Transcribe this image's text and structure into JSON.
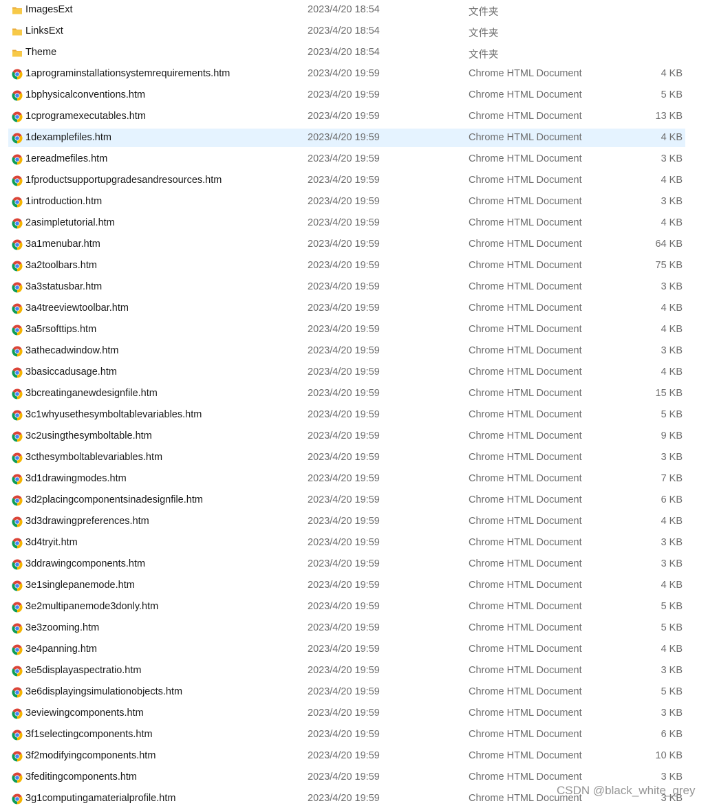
{
  "files": [
    {
      "name": "ImagesExt",
      "date": "2023/4/20 18:54",
      "type": "文件夹",
      "size": "",
      "kind": "folder"
    },
    {
      "name": "LinksExt",
      "date": "2023/4/20 18:54",
      "type": "文件夹",
      "size": "",
      "kind": "folder"
    },
    {
      "name": "Theme",
      "date": "2023/4/20 18:54",
      "type": "文件夹",
      "size": "",
      "kind": "folder"
    },
    {
      "name": "1aprograminstallationsystemrequirements.htm",
      "date": "2023/4/20 19:59",
      "type": "Chrome HTML Document",
      "size": "4 KB",
      "kind": "chrome"
    },
    {
      "name": "1bphysicalconventions.htm",
      "date": "2023/4/20 19:59",
      "type": "Chrome HTML Document",
      "size": "5 KB",
      "kind": "chrome"
    },
    {
      "name": "1cprogramexecutables.htm",
      "date": "2023/4/20 19:59",
      "type": "Chrome HTML Document",
      "size": "13 KB",
      "kind": "chrome"
    },
    {
      "name": "1dexamplefiles.htm",
      "date": "2023/4/20 19:59",
      "type": "Chrome HTML Document",
      "size": "4 KB",
      "kind": "chrome",
      "selected": true
    },
    {
      "name": "1ereadmefiles.htm",
      "date": "2023/4/20 19:59",
      "type": "Chrome HTML Document",
      "size": "3 KB",
      "kind": "chrome"
    },
    {
      "name": "1fproductsupportupgradesandresources.htm",
      "date": "2023/4/20 19:59",
      "type": "Chrome HTML Document",
      "size": "4 KB",
      "kind": "chrome"
    },
    {
      "name": "1introduction.htm",
      "date": "2023/4/20 19:59",
      "type": "Chrome HTML Document",
      "size": "3 KB",
      "kind": "chrome"
    },
    {
      "name": "2asimpletutorial.htm",
      "date": "2023/4/20 19:59",
      "type": "Chrome HTML Document",
      "size": "4 KB",
      "kind": "chrome"
    },
    {
      "name": "3a1menubar.htm",
      "date": "2023/4/20 19:59",
      "type": "Chrome HTML Document",
      "size": "64 KB",
      "kind": "chrome"
    },
    {
      "name": "3a2toolbars.htm",
      "date": "2023/4/20 19:59",
      "type": "Chrome HTML Document",
      "size": "75 KB",
      "kind": "chrome"
    },
    {
      "name": "3a3statusbar.htm",
      "date": "2023/4/20 19:59",
      "type": "Chrome HTML Document",
      "size": "3 KB",
      "kind": "chrome"
    },
    {
      "name": "3a4treeviewtoolbar.htm",
      "date": "2023/4/20 19:59",
      "type": "Chrome HTML Document",
      "size": "4 KB",
      "kind": "chrome"
    },
    {
      "name": "3a5rsofttips.htm",
      "date": "2023/4/20 19:59",
      "type": "Chrome HTML Document",
      "size": "4 KB",
      "kind": "chrome"
    },
    {
      "name": "3athecadwindow.htm",
      "date": "2023/4/20 19:59",
      "type": "Chrome HTML Document",
      "size": "3 KB",
      "kind": "chrome"
    },
    {
      "name": "3basiccadusage.htm",
      "date": "2023/4/20 19:59",
      "type": "Chrome HTML Document",
      "size": "4 KB",
      "kind": "chrome"
    },
    {
      "name": "3bcreatinganewdesignfile.htm",
      "date": "2023/4/20 19:59",
      "type": "Chrome HTML Document",
      "size": "15 KB",
      "kind": "chrome"
    },
    {
      "name": "3c1whyusethesymboltablevariables.htm",
      "date": "2023/4/20 19:59",
      "type": "Chrome HTML Document",
      "size": "5 KB",
      "kind": "chrome"
    },
    {
      "name": "3c2usingthesymboltable.htm",
      "date": "2023/4/20 19:59",
      "type": "Chrome HTML Document",
      "size": "9 KB",
      "kind": "chrome"
    },
    {
      "name": "3cthesymboltablevariables.htm",
      "date": "2023/4/20 19:59",
      "type": "Chrome HTML Document",
      "size": "3 KB",
      "kind": "chrome"
    },
    {
      "name": "3d1drawingmodes.htm",
      "date": "2023/4/20 19:59",
      "type": "Chrome HTML Document",
      "size": "7 KB",
      "kind": "chrome"
    },
    {
      "name": "3d2placingcomponentsinadesignfile.htm",
      "date": "2023/4/20 19:59",
      "type": "Chrome HTML Document",
      "size": "6 KB",
      "kind": "chrome"
    },
    {
      "name": "3d3drawingpreferences.htm",
      "date": "2023/4/20 19:59",
      "type": "Chrome HTML Document",
      "size": "4 KB",
      "kind": "chrome"
    },
    {
      "name": "3d4tryit.htm",
      "date": "2023/4/20 19:59",
      "type": "Chrome HTML Document",
      "size": "3 KB",
      "kind": "chrome"
    },
    {
      "name": "3ddrawingcomponents.htm",
      "date": "2023/4/20 19:59",
      "type": "Chrome HTML Document",
      "size": "3 KB",
      "kind": "chrome"
    },
    {
      "name": "3e1singlepanemode.htm",
      "date": "2023/4/20 19:59",
      "type": "Chrome HTML Document",
      "size": "4 KB",
      "kind": "chrome"
    },
    {
      "name": "3e2multipanemode3donly.htm",
      "date": "2023/4/20 19:59",
      "type": "Chrome HTML Document",
      "size": "5 KB",
      "kind": "chrome"
    },
    {
      "name": "3e3zooming.htm",
      "date": "2023/4/20 19:59",
      "type": "Chrome HTML Document",
      "size": "5 KB",
      "kind": "chrome"
    },
    {
      "name": "3e4panning.htm",
      "date": "2023/4/20 19:59",
      "type": "Chrome HTML Document",
      "size": "4 KB",
      "kind": "chrome"
    },
    {
      "name": "3e5displayaspectratio.htm",
      "date": "2023/4/20 19:59",
      "type": "Chrome HTML Document",
      "size": "3 KB",
      "kind": "chrome"
    },
    {
      "name": "3e6displayingsimulationobjects.htm",
      "date": "2023/4/20 19:59",
      "type": "Chrome HTML Document",
      "size": "5 KB",
      "kind": "chrome"
    },
    {
      "name": "3eviewingcomponents.htm",
      "date": "2023/4/20 19:59",
      "type": "Chrome HTML Document",
      "size": "3 KB",
      "kind": "chrome"
    },
    {
      "name": "3f1selectingcomponents.htm",
      "date": "2023/4/20 19:59",
      "type": "Chrome HTML Document",
      "size": "6 KB",
      "kind": "chrome"
    },
    {
      "name": "3f2modifyingcomponents.htm",
      "date": "2023/4/20 19:59",
      "type": "Chrome HTML Document",
      "size": "10 KB",
      "kind": "chrome"
    },
    {
      "name": "3feditingcomponents.htm",
      "date": "2023/4/20 19:59",
      "type": "Chrome HTML Document",
      "size": "3 KB",
      "kind": "chrome"
    },
    {
      "name": "3g1computingamaterialprofile.htm",
      "date": "2023/4/20 19:59",
      "type": "Chrome HTML Document",
      "size": "3 KB",
      "kind": "chrome"
    }
  ],
  "watermark": "CSDN @black_white_grey",
  "colors": {
    "selection": "#e5f3ff",
    "folder": "#f4c24d",
    "chrome_red": "#db4437",
    "chrome_yellow": "#f4b400",
    "chrome_green": "#0f9d58",
    "chrome_blue": "#4285f4"
  }
}
